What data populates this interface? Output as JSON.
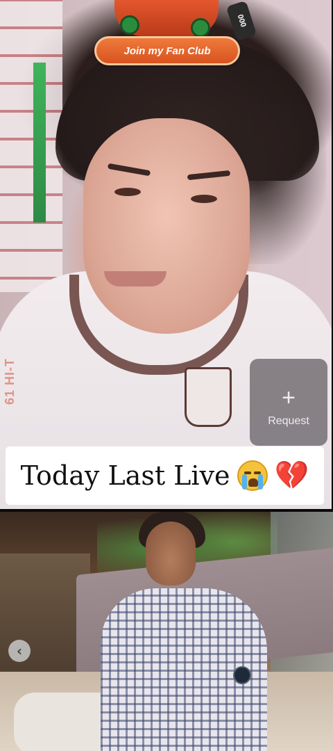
{
  "live": {
    "fan_club_label": "Join my Fan Club",
    "battery_text": "000",
    "shirt_print": "61 HI-T",
    "request": {
      "icon": "+",
      "label": "Request"
    }
  },
  "caption": {
    "text": "Today Last Live",
    "emojis": [
      "loudly-crying-face-icon",
      "broken-heart-icon"
    ],
    "broken_heart_glyph": "💔"
  },
  "carousel": {
    "prev_glyph": "‹"
  },
  "colors": {
    "fan_club_bg": "#e0602a",
    "fan_club_border": "#f6c89d",
    "request_bg": "#5f5a5f",
    "caption_bg": "#ffffff",
    "heart": "#e32b34"
  }
}
